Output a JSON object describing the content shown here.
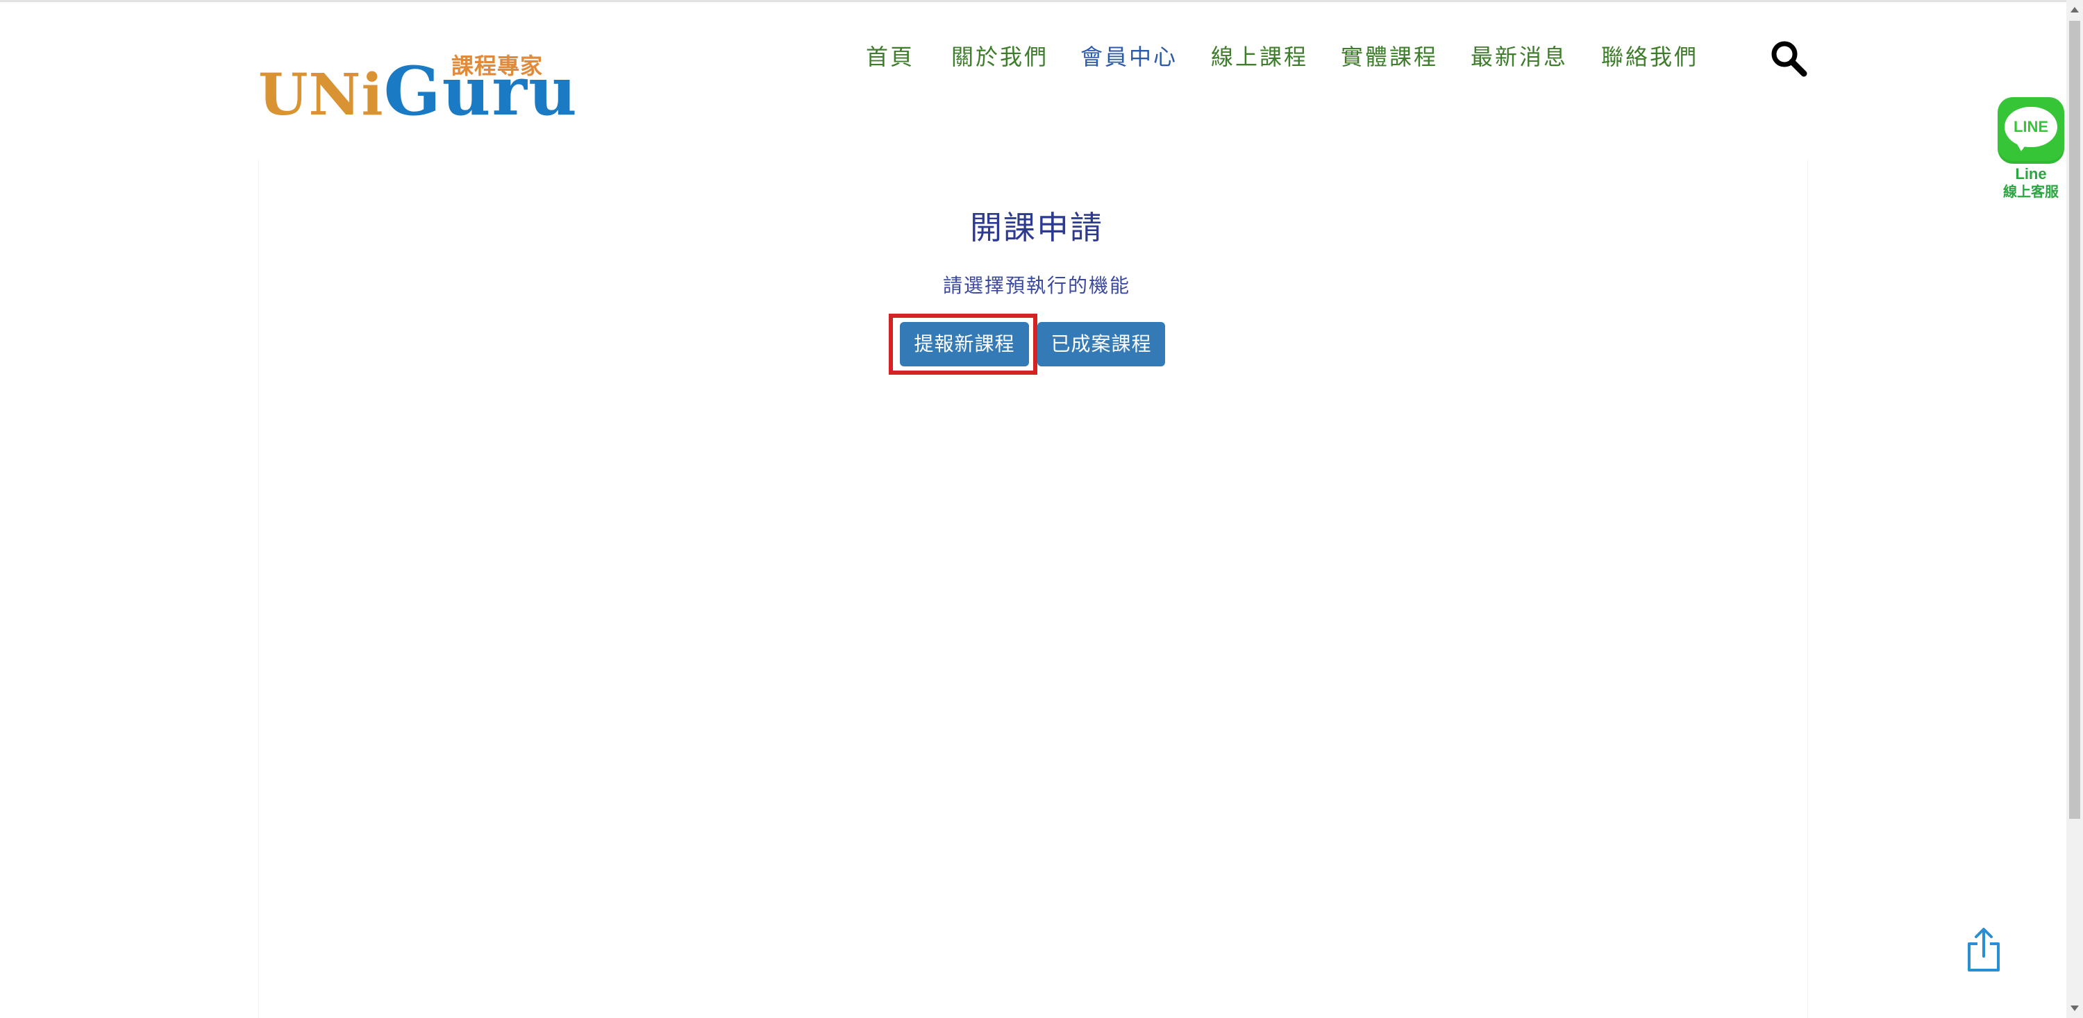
{
  "logo": {
    "tagline": "課程專家",
    "word_uni": "UNi",
    "word_guru": "Guru"
  },
  "nav": {
    "items": [
      {
        "label": "首頁",
        "active": false
      },
      {
        "label": "關於我們",
        "active": false
      },
      {
        "label": "會員中心",
        "active": true
      },
      {
        "label": "線上課程",
        "active": false
      },
      {
        "label": "實體課程",
        "active": false
      },
      {
        "label": "最新消息",
        "active": false
      },
      {
        "label": "聯絡我們",
        "active": false
      }
    ],
    "search_icon": "search-icon"
  },
  "line_badge": {
    "bubble_text": "LINE",
    "label": "Line",
    "sublabel": "線上客服"
  },
  "main": {
    "title": "開課申請",
    "subtitle": "請選擇預執行的機能",
    "buttons": {
      "new_course": "提報新課程",
      "completed_course": "已成案課程"
    }
  },
  "colors": {
    "nav_text": "#3e7d2b",
    "nav_active": "#2c5aa8",
    "title": "#2c3a94",
    "button_bg": "#337ab7",
    "highlight": "#d32323",
    "line_green": "#35c537",
    "logo_orange": "#d99333",
    "logo_blue": "#1a7bc4"
  },
  "icons": {
    "share": "share-icon"
  }
}
